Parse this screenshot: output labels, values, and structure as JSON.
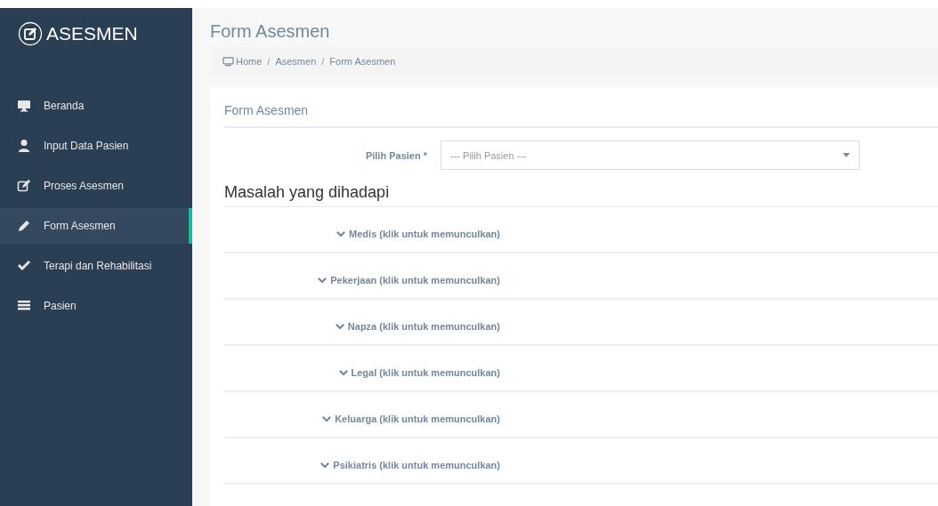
{
  "brand": {
    "title": "ASESMEN"
  },
  "sidebar": {
    "items": [
      {
        "label": "Beranda",
        "kind": "monitor",
        "selected": false
      },
      {
        "label": "Input Data Pasien",
        "kind": "user",
        "selected": false
      },
      {
        "label": "Proses Asesmen",
        "kind": "edit",
        "selected": false
      },
      {
        "label": "Form Asesmen",
        "kind": "pencil",
        "selected": true
      },
      {
        "label": "Terapi dan Rehabilitasi",
        "kind": "check",
        "selected": false
      },
      {
        "label": "Pasien",
        "kind": "list",
        "selected": false
      }
    ]
  },
  "page_title": "Form Asesmen",
  "breadcrumb": [
    {
      "label": "Home"
    },
    {
      "separator": "/",
      "label": "Asesmen"
    },
    {
      "separator": "/",
      "label": "Form Asesmen"
    }
  ],
  "panel": {
    "title": "Form Asesmen",
    "patient_field": {
      "label": "Pilih Pasien *",
      "placeholder": "--- Pilih Pasien ---"
    },
    "section_heading": "Masalah yang dihadapi",
    "sections": [
      {
        "label": "Medis (klik untuk memunculkan)"
      },
      {
        "label": "Pekerjaan (klik untuk memunculkan)"
      },
      {
        "label": "Napza (klik untuk memunculkan)"
      },
      {
        "label": "Legal (klik untuk memunculkan)"
      },
      {
        "label": "Keluarga (klik untuk memunculkan)"
      },
      {
        "label": "Psikiatris (klik untuk memunculkan)"
      }
    ]
  }
}
